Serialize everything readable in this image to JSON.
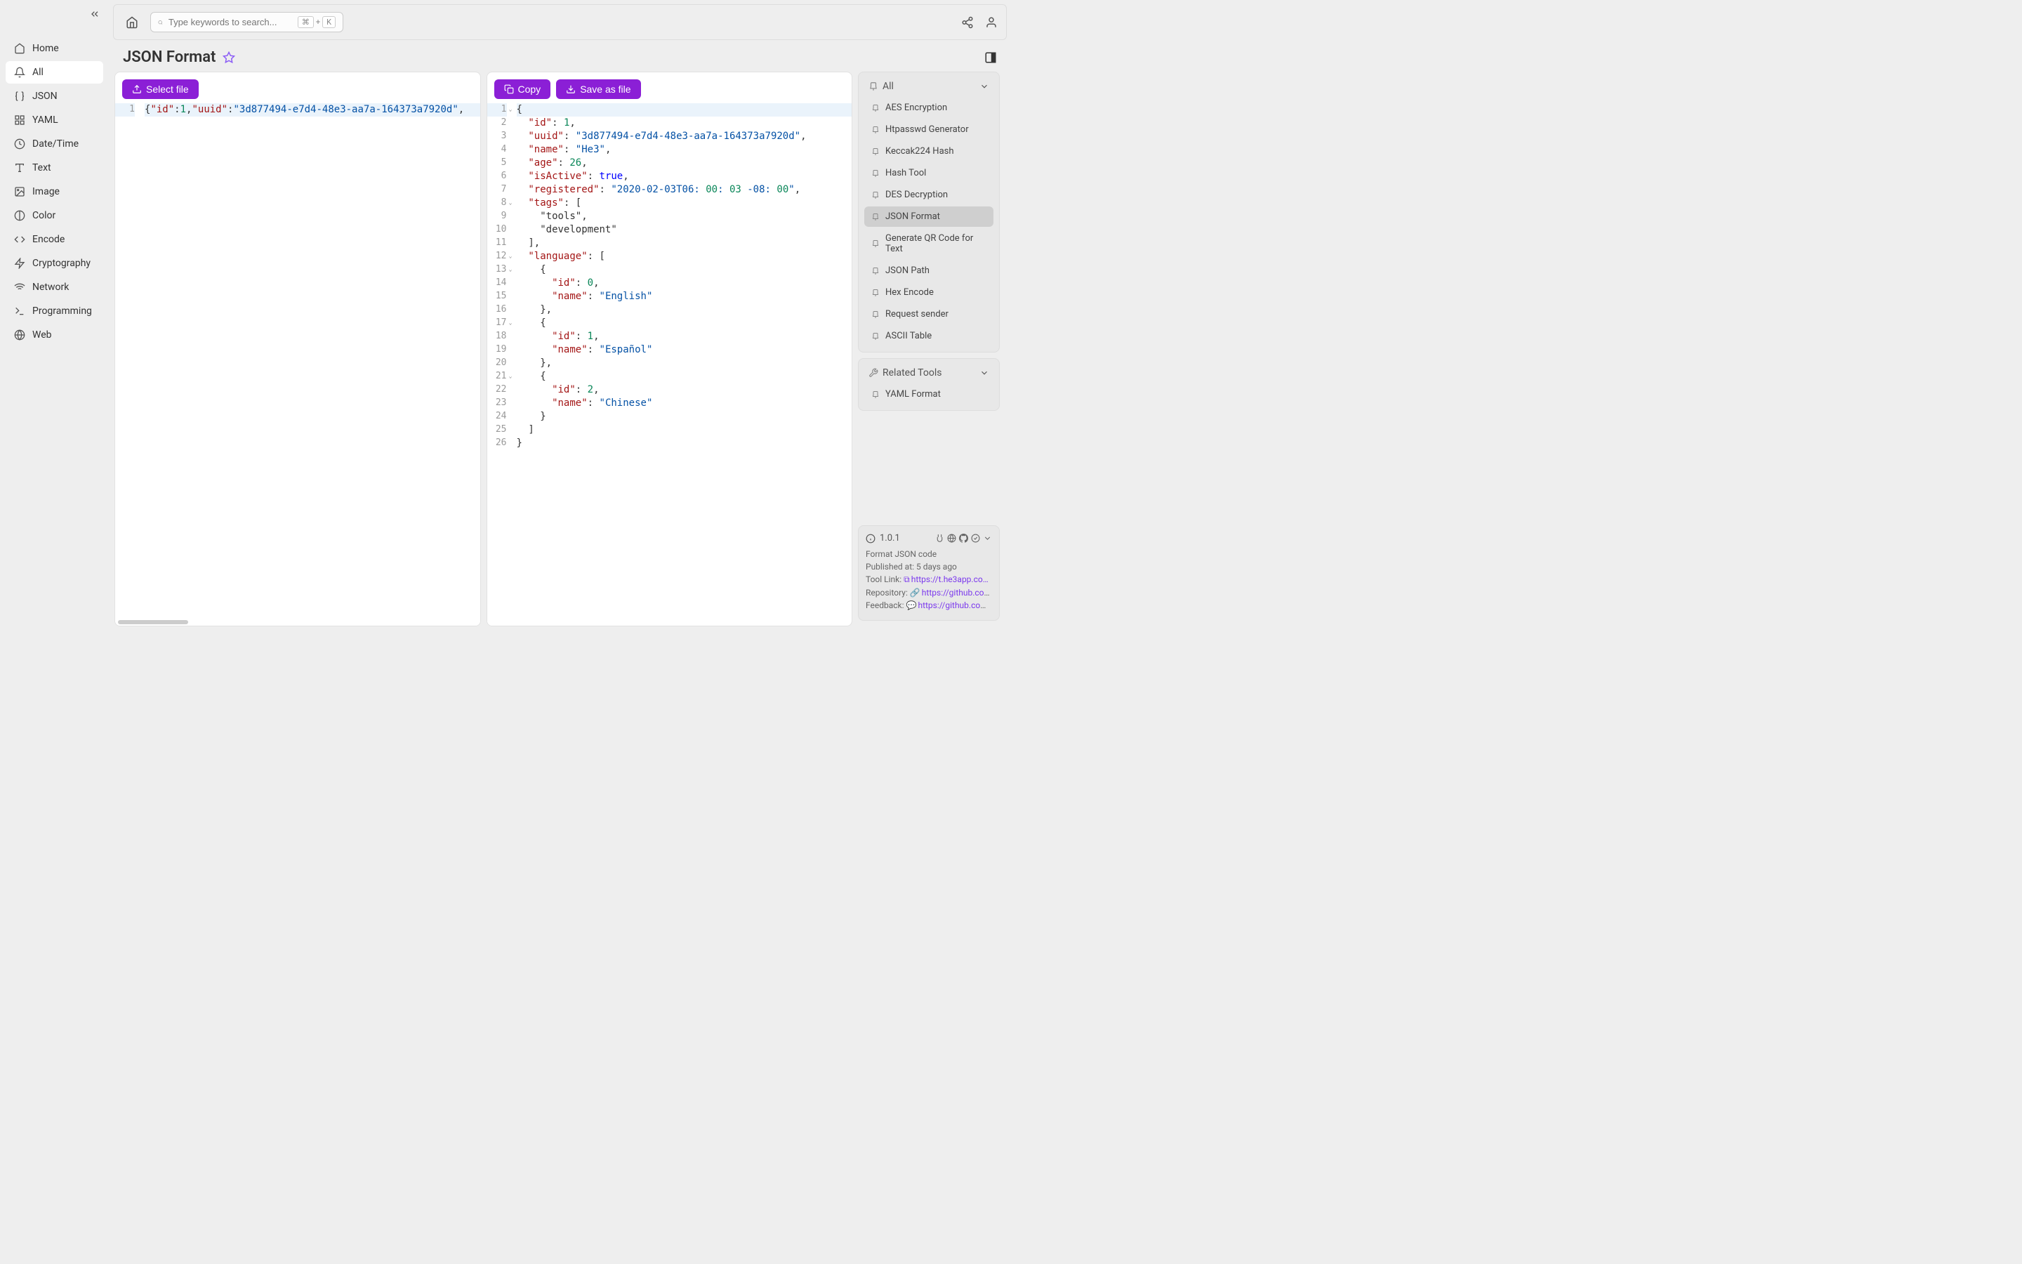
{
  "sidebar": {
    "items": [
      {
        "label": "Home",
        "icon": "home"
      },
      {
        "label": "All",
        "icon": "bell"
      },
      {
        "label": "JSON",
        "icon": "braces"
      },
      {
        "label": "YAML",
        "icon": "grid"
      },
      {
        "label": "Date/Time",
        "icon": "clock"
      },
      {
        "label": "Text",
        "icon": "text"
      },
      {
        "label": "Image",
        "icon": "image"
      },
      {
        "label": "Color",
        "icon": "palette"
      },
      {
        "label": "Encode",
        "icon": "code"
      },
      {
        "label": "Cryptography",
        "icon": "bolt"
      },
      {
        "label": "Network",
        "icon": "wifi"
      },
      {
        "label": "Programming",
        "icon": "terminal"
      },
      {
        "label": "Web",
        "icon": "globe"
      }
    ],
    "active_index": 1
  },
  "search": {
    "placeholder": "Type keywords to search...",
    "kbd1": "⌘",
    "plus": "+",
    "kbd2": "K"
  },
  "title": "JSON Format",
  "buttons": {
    "select_file": "Select file",
    "copy": "Copy",
    "save_as_file": "Save as file"
  },
  "input_code": {
    "line1": "{\"id\":1,\"uuid\":\"3d877494-e7d4-48e3-aa7a-164373a7920d\","
  },
  "output_code": {
    "lines": [
      "{",
      "  \"id\": 1,",
      "  \"uuid\": \"3d877494-e7d4-48e3-aa7a-164373a7920d\",",
      "  \"name\": \"He3\",",
      "  \"age\": 26,",
      "  \"isActive\": true,",
      "  \"registered\": \"2020-02-03T06:00:03 -08:00\",",
      "  \"tags\": [",
      "    \"tools\",",
      "    \"development\"",
      "  ],",
      "  \"language\": [",
      "    {",
      "      \"id\": 0,",
      "      \"name\": \"English\"",
      "    },",
      "    {",
      "      \"id\": 1,",
      "      \"name\": \"Español\"",
      "    },",
      "    {",
      "      \"id\": 2,",
      "      \"name\": \"Chinese\"",
      "    }",
      "  ]",
      "}"
    ]
  },
  "right_panels": {
    "all": {
      "header": "All",
      "items": [
        "AES Encryption",
        "Htpasswd Generator",
        "Keccak224 Hash",
        "Hash Tool",
        "DES Decryption",
        "JSON Format",
        "Generate QR Code for Text",
        "JSON Path",
        "Hex Encode",
        "Request sender",
        "ASCII Table"
      ],
      "active_index": 5
    },
    "related": {
      "header": "Related Tools",
      "items": [
        "YAML Format"
      ]
    }
  },
  "info": {
    "version": "1.0.1",
    "desc": "Format JSON code",
    "published_label": "Published at: ",
    "published_value": "5 days ago",
    "tool_link_label": "Tool Link: ",
    "tool_link_value": "https://t.he3app.co…",
    "repo_label": "Repository: ",
    "repo_value": "https://github.com/…",
    "feedback_label": "Feedback: ",
    "feedback_value": "https://github.com/…"
  }
}
